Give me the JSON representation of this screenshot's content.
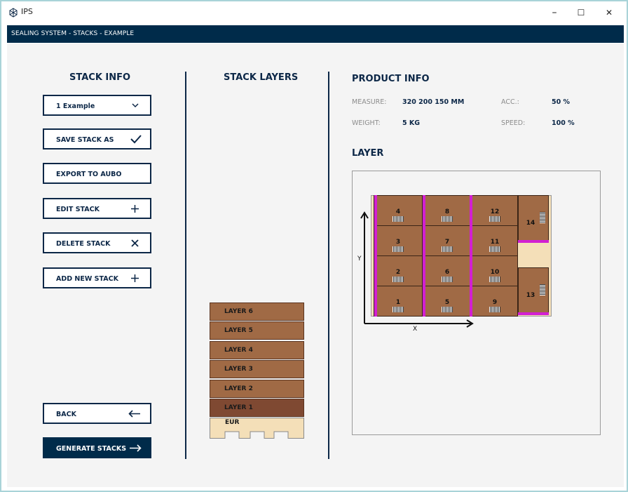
{
  "window": {
    "title": "IPS",
    "min": "–",
    "max": "☐",
    "close": "✕"
  },
  "appbar": {
    "breadcrumb": "SEALING SYSTEM - STACKS - EXAMPLE"
  },
  "stack_info": {
    "heading": "STACK INFO",
    "select_value": "1 Example",
    "buttons": {
      "save": "SAVE STACK AS",
      "export": "EXPORT TO AUBO",
      "edit": "EDIT STACK",
      "delete": "DELETE STACK",
      "add": "ADD NEW STACK",
      "back": "BACK",
      "generate": "GENERATE STACKS"
    },
    "icons": {
      "save": "checkmark-icon",
      "edit": "plus-icon",
      "delete": "close-icon",
      "add": "plus-icon",
      "back": "arrow-left-icon",
      "generate": "arrow-right-icon",
      "select": "chevron-down-icon"
    }
  },
  "stack_layers": {
    "heading": "STACK LAYERS",
    "layers": [
      "LAYER 6",
      "LAYER 5",
      "LAYER 4",
      "LAYER 3",
      "LAYER 2",
      "LAYER 1"
    ],
    "selected": "LAYER 1",
    "pallet": "EUR"
  },
  "product_info": {
    "heading": "PRODUCT INFO",
    "measure_label": "MEASURE:",
    "measure_value": "320 200 150 MM",
    "acc_label": "ACC.:",
    "acc_value": "50 %",
    "weight_label": "WEIGHT:",
    "weight_value": "5 KG",
    "speed_label": "SPEED:",
    "speed_value": "100 %"
  },
  "layer_view": {
    "heading": "LAYER",
    "axis_x": "X",
    "axis_y": "Y",
    "boxes": [
      "1",
      "2",
      "3",
      "4",
      "5",
      "6",
      "7",
      "8",
      "9",
      "10",
      "11",
      "12",
      "13",
      "14"
    ]
  },
  "colors": {
    "accent": "#002b4a",
    "box": "#a06a45",
    "selected_layer": "#7f4932",
    "pallet": "#f4dfb8",
    "separator": "#d21fd2"
  }
}
